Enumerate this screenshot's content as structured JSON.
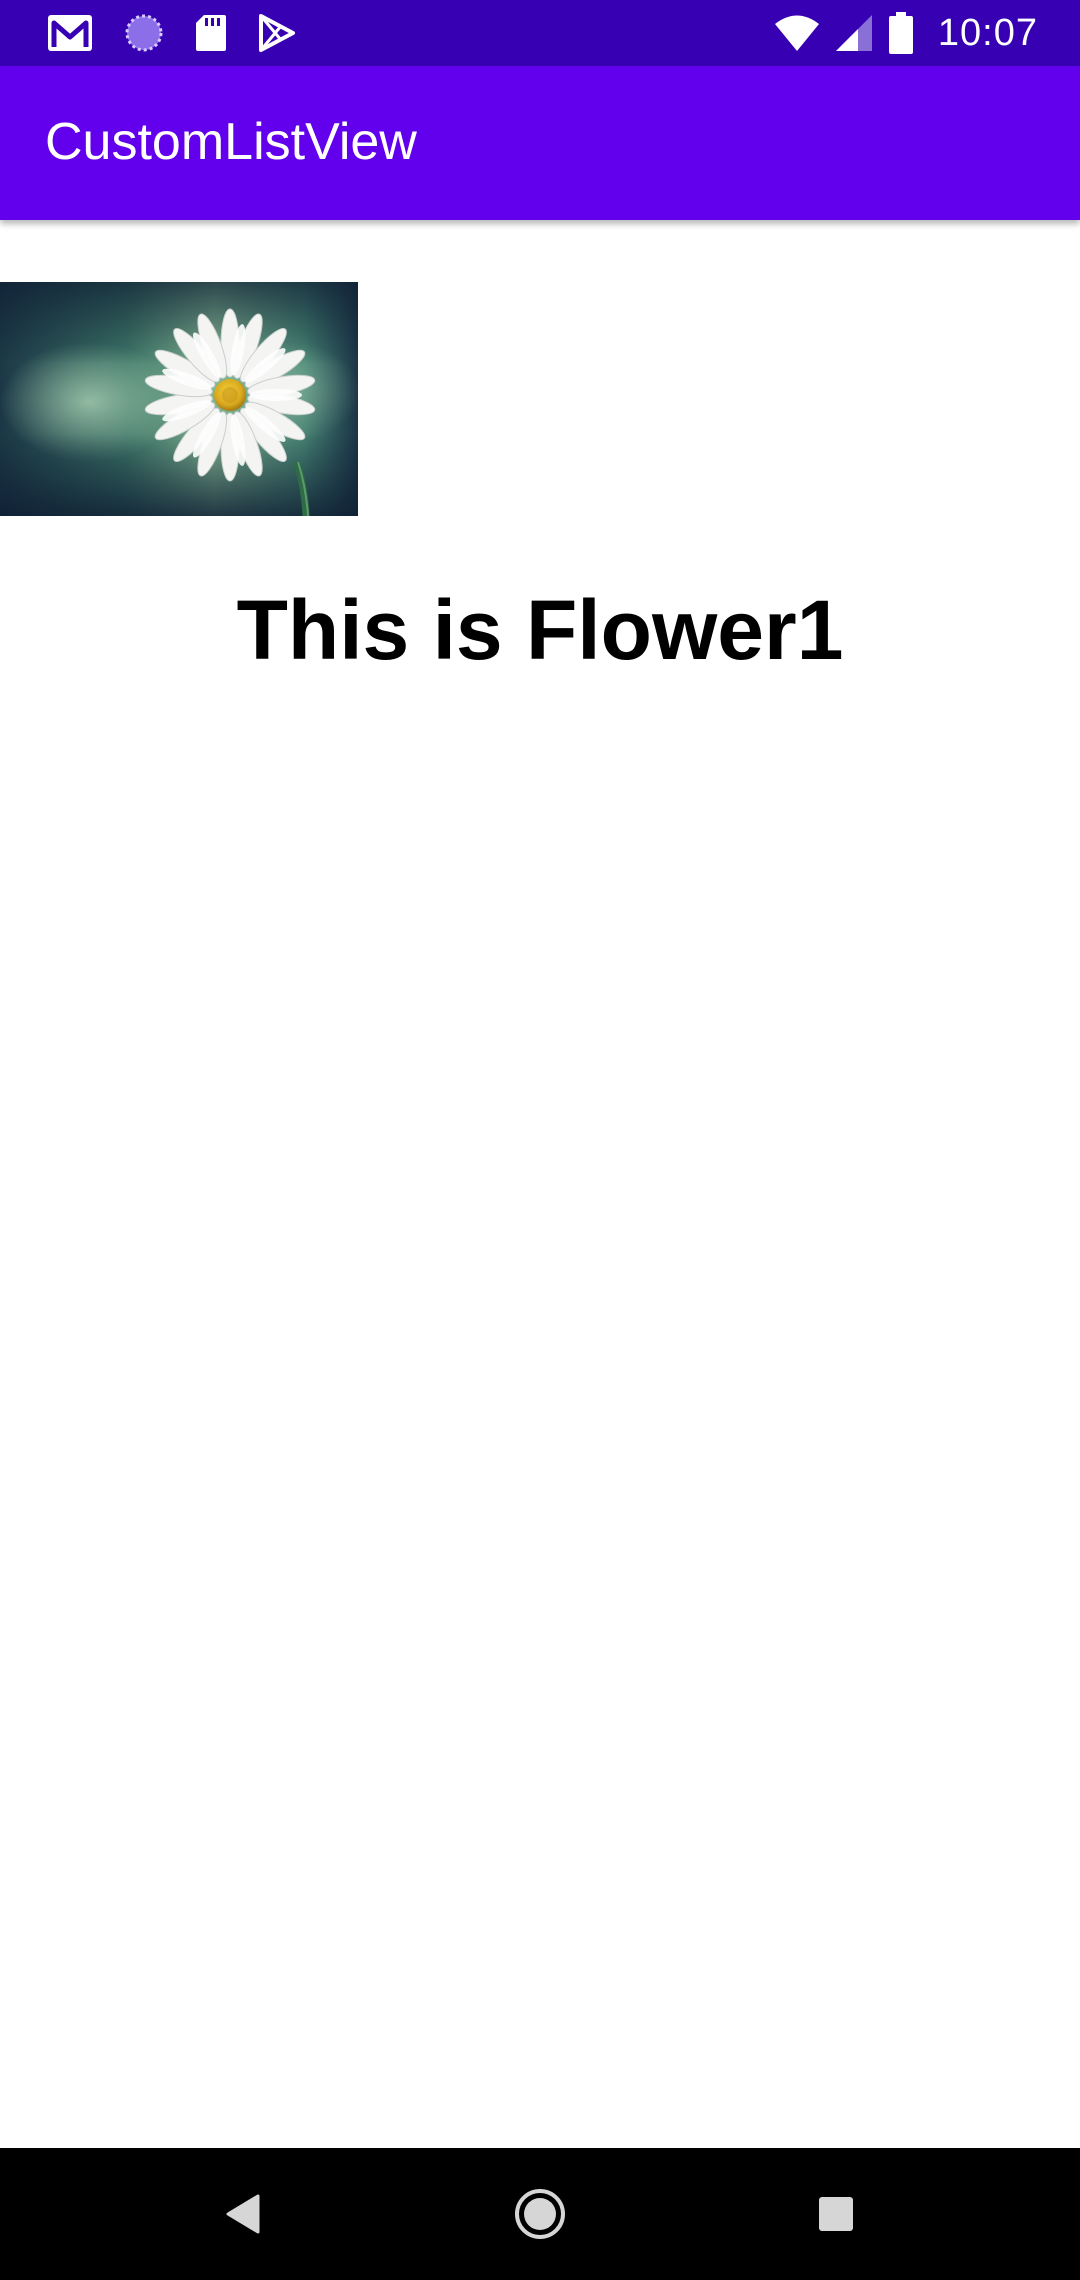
{
  "status_bar": {
    "time": "10:07",
    "left_icons": [
      "gmail-icon",
      "loading-circle-icon",
      "sd-card-icon",
      "play-store-icon"
    ],
    "right_icons": [
      "wifi-icon",
      "cellular-signal-icon",
      "battery-icon"
    ]
  },
  "app_bar": {
    "title": "CustomListView"
  },
  "list": {
    "items": [
      {
        "image_icon": "daisy-flower-image",
        "caption": "This is Flower1"
      }
    ]
  },
  "nav_bar": {
    "buttons": [
      "back-icon",
      "home-icon",
      "recents-icon"
    ]
  },
  "colors": {
    "status_bar": "#3700b3",
    "app_bar": "#6200ee",
    "background": "#ffffff",
    "nav_bar": "#000000",
    "caption_text": "#000000"
  }
}
